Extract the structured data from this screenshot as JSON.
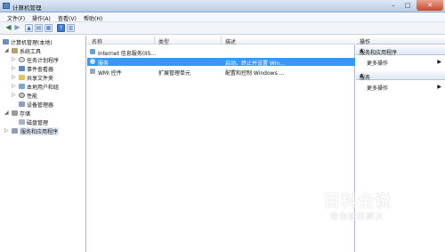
{
  "window": {
    "title": "计算机管理"
  },
  "menu": [
    "文件(F)",
    "操作(A)",
    "查看(V)",
    "帮助(H)"
  ],
  "tree": {
    "root": "计算机管理(本地)",
    "system_tools": "系统工具",
    "task_scheduler": "任务计划程序",
    "event_viewer": "事件查看器",
    "shared_folders": "共享文件夹",
    "local_users": "本地用户和组",
    "performance": "性能",
    "device_manager": "设备管理器",
    "storage": "存储",
    "disk_management": "磁盘管理",
    "services_apps": "服务和应用程序"
  },
  "list": {
    "columns": [
      "名称",
      "类型",
      "描述"
    ],
    "rows": [
      {
        "name": "Internet 信息服务(IIS...",
        "type": "",
        "desc": ""
      },
      {
        "name": "服务",
        "type": "",
        "desc": "启动、终止并设置 Win..."
      },
      {
        "name": "WMI 控件",
        "type": "扩展管理单元",
        "desc": "配置和控制 Windows ..."
      }
    ]
  },
  "actions": {
    "header": "操作",
    "section1": "服务和应用程序",
    "more1": "更多操作",
    "section2": "服务",
    "more2": "更多操作"
  },
  "watermark": {
    "brand": "百科全说",
    "tagline": "助你轻松解决"
  }
}
